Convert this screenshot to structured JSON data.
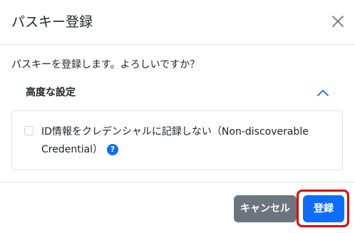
{
  "dialog": {
    "title": "パスキー登録",
    "close_label": "×"
  },
  "body": {
    "message": "パスキーを登録します。よろしいですか？",
    "advanced": {
      "title": "高度な設定",
      "expanded": true,
      "option_label_line1": "ID情報をクレデンシャルに記録しない（Non-discoverable",
      "option_label_line2": "Credential）",
      "option_checked": false,
      "help_icon": "?"
    }
  },
  "footer": {
    "cancel_label": "キャンセル",
    "register_label": "登録"
  },
  "colors": {
    "primary": "#0d6efd",
    "secondary": "#6c757d",
    "highlight": "#e00000"
  }
}
